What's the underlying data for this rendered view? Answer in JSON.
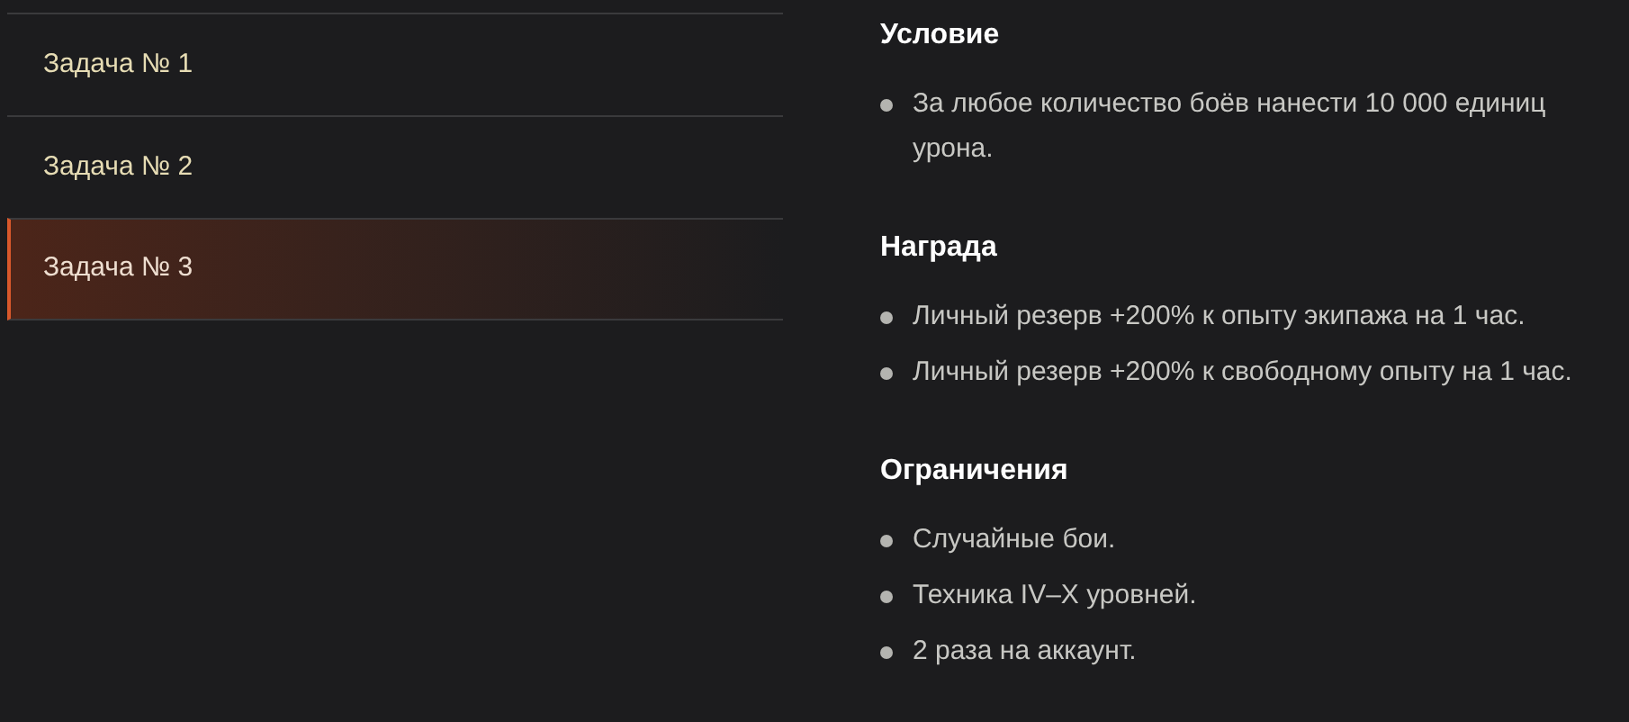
{
  "tasks": [
    {
      "label": "Задача № 1",
      "selected": false
    },
    {
      "label": "Задача № 2",
      "selected": false
    },
    {
      "label": "Задача № 3",
      "selected": true
    }
  ],
  "sections": [
    {
      "title": "Условие",
      "items": [
        "За любое количество боёв нанести 10 000 единиц урона."
      ]
    },
    {
      "title": "Награда",
      "items": [
        "Личный резерв +200% к опыту экипажа на 1 час.",
        "Личный резерв +200% к свободному опыту на 1 час."
      ]
    },
    {
      "title": "Ограничения",
      "items": [
        "Случайные бои.",
        "Техника IV–X уровней.",
        "2 раза на аккаунт."
      ]
    }
  ]
}
